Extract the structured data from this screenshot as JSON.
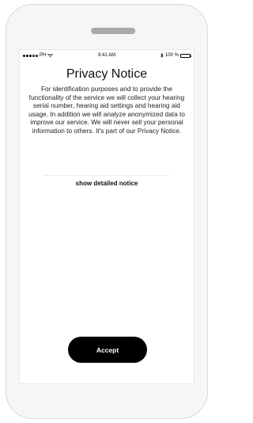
{
  "status_bar": {
    "carrier": "PH",
    "time": "9:41 AM",
    "battery_percent_label": "100 %",
    "battery_level": 1.0
  },
  "privacy": {
    "title": "Privacy Notice",
    "body": "For identification purposes and to provide the functionality of the service we will collect your hearing serial number, hearing aid settings and hearing aid usage. In addition we will analyze anonymized data to improve our service. We will never sell your personal information to others. It's part of our Privacy Notice.",
    "detail_link": "show detailed notice"
  },
  "actions": {
    "accept_label": "Accept"
  }
}
